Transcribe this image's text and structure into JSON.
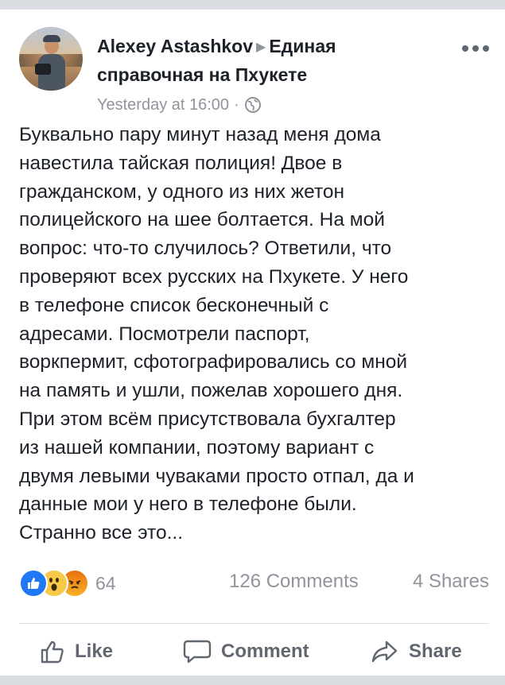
{
  "post": {
    "author": "Alexey Astashkov",
    "group": "Единая справочная на Пхукете",
    "timestamp": "Yesterday at 16:00",
    "separator": "·",
    "privacy_icon": "globe-icon",
    "menu_icon": "more-horizontal-icon",
    "text": "Буквально пару минут назад меня дома\nнавестила тайская полиция! Двое в\nгражданском, у одного из них жетон\nполицейского на шее болтается. На мой\nвопрос: что-то случилось? Ответили, что\nпроверяют всех русских на Пхукете. У него\nв телефоне список бесконечный с\nадресами. Посмотрели паспорт,\nворкпермит, сфотографировались со мной\nна память и ушли, пожелав хорошего дня.\nПри этом всём присутствовала бухгалтер\nиз нашей компании, поэтому вариант с\nдвумя левыми чуваками просто отпал, да и\nданные мои у него в телефоне были.\nСтранно все это..."
  },
  "stats": {
    "reactions": [
      "like",
      "wow",
      "angry"
    ],
    "reaction_count": "64",
    "comments": "126 Comments",
    "shares": "4 Shares"
  },
  "actions": {
    "like": "Like",
    "comment": "Comment",
    "share": "Share"
  },
  "colors": {
    "like_blue": "#2078f4",
    "text": "#1d2129",
    "muted": "#90949c"
  }
}
